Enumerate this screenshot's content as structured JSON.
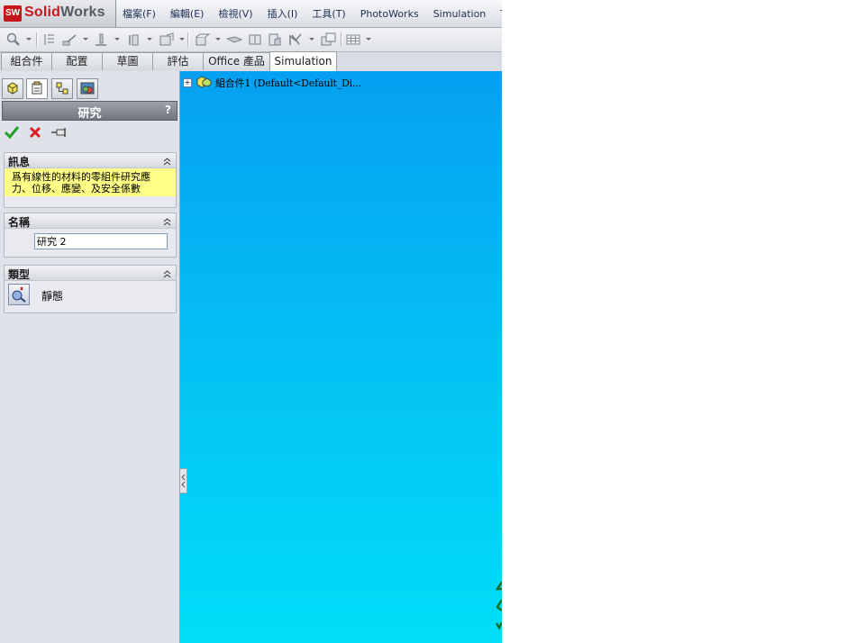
{
  "app": {
    "logo_text": "SolidWorks",
    "logo_mark": "SW",
    "brand_color": "#c8161d"
  },
  "menu": {
    "items": [
      "檔案(F)",
      "編輯(E)",
      "檢視(V)",
      "插入(I)",
      "工具(T)",
      "PhotoWorks",
      "Simulation",
      "Te"
    ]
  },
  "toolbar": {
    "icons": [
      "zoom-icon",
      "rebuild-icon",
      "sketch-icon",
      "measure-icon",
      "reference-icon",
      "section-view-icon",
      "view-orientation-icon",
      "display-style-icon",
      "hide-show-icon",
      "appearance-icon",
      "scene-icon",
      "view-settings-icon",
      "table-icon"
    ]
  },
  "tabs": {
    "items": [
      "組合件",
      "配置",
      "草圖",
      "評估",
      "Office 產品",
      "Simulation"
    ],
    "active": "Simulation"
  },
  "panel": {
    "tabs": [
      "feature-manager-icon",
      "property-manager-icon",
      "configuration-manager-icon",
      "display-manager-icon"
    ],
    "title": "研究",
    "help": "?",
    "groups": {
      "message": {
        "label": "訊息",
        "line1": "爲有線性的材料的零組件研究應",
        "line2": "力、位移、應變、及安全係數"
      },
      "name": {
        "label": "名稱",
        "value": "研究 2"
      },
      "type": {
        "label": "類型",
        "value": "靜態"
      }
    }
  },
  "viewport": {
    "tree_root": "組合件1  (Default<Default_Di...",
    "bg_top": "#05a0f2",
    "bg_bottom": "#00def8"
  }
}
